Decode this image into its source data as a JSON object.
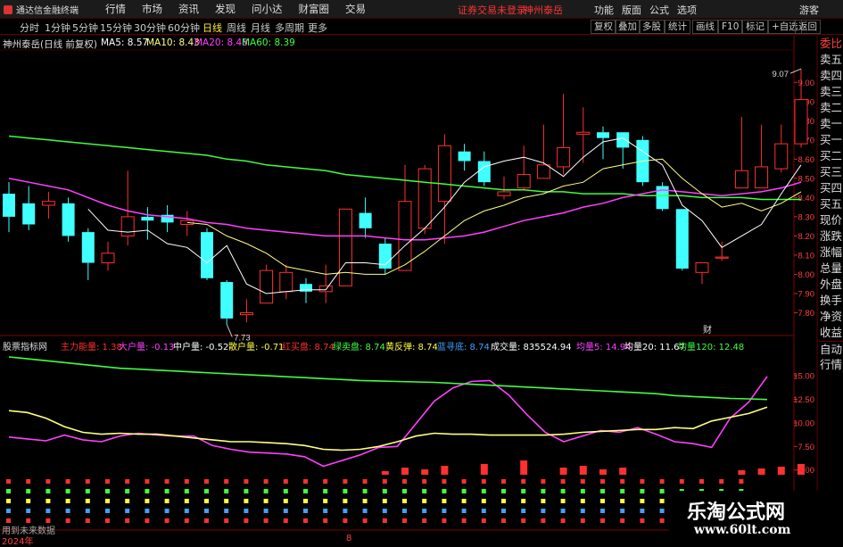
{
  "menubar": {
    "app": "通达信金融终端",
    "items": [
      "行情",
      "市场",
      "资讯",
      "发现",
      "问小达",
      "财富圈",
      "交易"
    ],
    "login": "证券交易未登录",
    "stock": "神州泰岳",
    "right": [
      "功能",
      "版面",
      "公式",
      "选项"
    ],
    "guest": "游客"
  },
  "tabs": {
    "items": [
      "分时",
      "1分钟",
      "5分钟",
      "15分钟",
      "30分钟",
      "60分钟",
      "日线",
      "周线",
      "月线",
      "多周期",
      "更多"
    ],
    "active": "日线",
    "right": [
      "复权",
      "叠加",
      "多股",
      "统计",
      "画线",
      "F10",
      "标记",
      "+自选",
      "返回"
    ]
  },
  "info": {
    "title": "神州泰岳(日线 前复权)",
    "ma5": "MA5: 8.57",
    "ma10": "MA10: 8.43",
    "ma20": "MA20: 8.48",
    "ma60": "MA60: 8.39"
  },
  "indicator": {
    "name": "股票指标网",
    "items": [
      {
        "t": "主力能量: 1.38",
        "c": "#ff3030"
      },
      {
        "t": "大户量: -0.13",
        "c": "#ff40ff"
      },
      {
        "t": "中户量: -0.52",
        "c": "#ffffff"
      },
      {
        "t": "散户量: -0.71",
        "c": "#ffff40"
      },
      {
        "t": "红买盘: 8.74",
        "c": "#ff3030"
      },
      {
        "t": "绿卖盘: 8.74",
        "c": "#40ff40"
      },
      {
        "t": "黄反弹: 8.74",
        "c": "#ffff40"
      },
      {
        "t": "蓝寻底: 8.74",
        "c": "#40a0ff"
      },
      {
        "t": "成交量: 835524.94",
        "c": "#ffffff"
      },
      {
        "t": "均量5: 14.94",
        "c": "#ff40ff"
      },
      {
        "t": "均量20: 11.67",
        "c": "#ffffff"
      },
      {
        "t": "均量120: 12.48",
        "c": "#40ff40"
      }
    ]
  },
  "sidebar": {
    "items": [
      "委比",
      "卖五",
      "卖四",
      "卖三",
      "卖二",
      "卖一",
      "买一",
      "买二",
      "买三",
      "买四",
      "买五",
      "现价",
      "涨跌",
      "涨幅",
      "总量",
      "外盘",
      "换手",
      "净资",
      "收益"
    ],
    "bottom": [
      "自动",
      "行情"
    ]
  },
  "labels": {
    "high": "9.07",
    "low": "7.73",
    "cai": "财",
    "nofuture": "用到未来数据",
    "year": "2024年",
    "month": "8"
  },
  "watermark": {
    "line1": "乐淘公式网",
    "line2": "www.60lt.com"
  },
  "colors": {
    "up": "#ff3030",
    "down": "#40ffff",
    "ma5": "#ffffff",
    "ma10": "#ffff80",
    "ma20": "#ff40ff",
    "ma60": "#40ff40"
  },
  "chart_data": [
    {
      "type": "candlestick",
      "ylim": [
        7.7,
        9.15
      ],
      "yticks": [
        7.8,
        7.9,
        8.0,
        8.1,
        8.2,
        8.3,
        8.4,
        8.5,
        8.6,
        8.7,
        8.8,
        8.9,
        9.0
      ],
      "candles": [
        [
          8.42,
          8.3,
          8.48,
          8.22
        ],
        [
          8.37,
          8.26,
          8.46,
          8.23
        ],
        [
          8.36,
          8.38,
          8.43,
          8.29
        ],
        [
          8.37,
          8.2,
          8.4,
          8.17
        ],
        [
          8.22,
          8.06,
          8.24,
          7.97
        ],
        [
          8.06,
          8.11,
          8.17,
          8.02
        ],
        [
          8.2,
          8.3,
          8.54,
          8.15
        ],
        [
          8.3,
          8.28,
          8.35,
          8.18
        ],
        [
          8.31,
          8.27,
          8.36,
          8.22
        ],
        [
          8.26,
          8.28,
          8.33,
          8.2
        ],
        [
          8.22,
          7.98,
          8.24,
          7.97
        ],
        [
          7.96,
          7.77,
          7.97,
          7.74
        ],
        [
          7.79,
          7.8,
          7.87,
          7.75
        ],
        [
          7.85,
          8.02,
          8.05,
          7.85
        ],
        [
          7.91,
          8.01,
          8.05,
          7.87
        ],
        [
          7.95,
          7.91,
          7.98,
          7.85
        ],
        [
          7.91,
          7.94,
          8.05,
          7.85
        ],
        [
          7.94,
          8.34,
          8.34,
          7.94
        ],
        [
          8.32,
          8.24,
          8.4,
          8.19
        ],
        [
          8.16,
          8.03,
          8.19,
          8.0
        ],
        [
          8.02,
          8.38,
          8.57,
          8.02
        ],
        [
          8.24,
          8.55,
          8.57,
          8.21
        ],
        [
          8.38,
          8.67,
          8.73,
          8.16
        ],
        [
          8.64,
          8.59,
          8.68,
          8.54
        ],
        [
          8.59,
          8.48,
          8.64,
          8.46
        ],
        [
          8.41,
          8.43,
          8.51,
          8.39
        ],
        [
          8.45,
          8.52,
          8.67,
          8.44
        ],
        [
          8.5,
          8.57,
          8.78,
          8.51
        ],
        [
          8.56,
          8.66,
          8.94,
          8.52
        ],
        [
          8.73,
          8.74,
          8.87,
          8.58
        ],
        [
          8.74,
          8.71,
          8.77,
          8.6
        ],
        [
          8.74,
          8.66,
          8.7,
          8.55
        ],
        [
          8.7,
          8.48,
          8.72,
          8.46
        ],
        [
          8.46,
          8.34,
          8.48,
          8.33
        ],
        [
          8.34,
          8.03,
          8.34,
          8.02
        ],
        [
          8.01,
          8.06,
          8.06,
          7.95
        ],
        [
          8.09,
          8.09,
          8.17,
          8.07
        ],
        [
          8.45,
          8.54,
          8.82,
          8.45
        ],
        [
          8.45,
          8.56,
          8.78,
          8.46
        ],
        [
          8.55,
          8.68,
          8.78,
          8.53
        ],
        [
          8.68,
          8.91,
          9.07,
          8.66
        ]
      ],
      "ma": {
        "ma5": [
          null,
          null,
          null,
          null,
          8.34,
          8.23,
          8.22,
          8.23,
          8.16,
          8.14,
          8.06,
          8.15,
          7.95,
          7.9,
          7.91,
          7.92,
          7.92,
          8.06,
          8.06,
          8.05,
          8.15,
          8.24,
          8.35,
          8.48,
          8.56,
          8.59,
          8.61,
          8.58,
          8.51,
          8.61,
          8.69,
          8.71,
          8.64,
          8.57,
          8.36,
          8.28,
          8.14,
          8.2,
          8.26,
          8.42,
          8.57
        ],
        "ma10": [
          null,
          null,
          null,
          null,
          null,
          null,
          null,
          null,
          null,
          8.27,
          8.26,
          8.2,
          8.16,
          8.11,
          8.04,
          8.02,
          8.0,
          8.01,
          8.0,
          8.0,
          8.05,
          8.12,
          8.2,
          8.28,
          8.33,
          8.36,
          8.4,
          8.42,
          8.46,
          8.48,
          8.55,
          8.57,
          8.59,
          8.6,
          8.5,
          8.42,
          8.35,
          8.37,
          8.33,
          8.37,
          8.43
        ],
        "ma20": [
          8.5,
          8.48,
          8.46,
          8.44,
          8.4,
          8.36,
          8.33,
          8.31,
          8.3,
          8.29,
          8.27,
          8.26,
          8.24,
          8.23,
          8.22,
          8.21,
          8.2,
          8.2,
          8.2,
          8.19,
          8.18,
          8.18,
          8.19,
          8.2,
          8.22,
          8.25,
          8.28,
          8.3,
          8.32,
          8.35,
          8.37,
          8.4,
          8.42,
          8.44,
          8.43,
          8.42,
          8.41,
          8.42,
          8.43,
          8.45,
          8.48
        ],
        "ma60": [
          8.72,
          8.71,
          8.7,
          8.69,
          8.68,
          8.67,
          8.66,
          8.65,
          8.64,
          8.63,
          8.62,
          8.6,
          8.59,
          8.57,
          8.56,
          8.55,
          8.54,
          8.52,
          8.51,
          8.5,
          8.49,
          8.48,
          8.47,
          8.46,
          8.45,
          8.44,
          8.44,
          8.43,
          8.43,
          8.42,
          8.42,
          8.42,
          8.41,
          8.41,
          8.41,
          8.4,
          8.4,
          8.4,
          8.39,
          8.39,
          8.39
        ]
      }
    },
    {
      "type": "line",
      "ylim": [
        4.5,
        17.0
      ],
      "yticks": [
        5.0,
        7.5,
        10.0,
        12.5,
        15.0
      ],
      "series": [
        {
          "name": "均量5",
          "color": "#ff40ff",
          "values": [
            8.5,
            8.3,
            8.1,
            8.7,
            8.2,
            8.0,
            8.6,
            8.9,
            8.7,
            8.6,
            8.6,
            7.6,
            7.2,
            6.9,
            6.8,
            6.7,
            6.4,
            5.4,
            6.0,
            6.6,
            7.4,
            7.5,
            9.9,
            12.3,
            13.7,
            14.4,
            14.5,
            13.0,
            10.9,
            9.0,
            8.0,
            8.6,
            9.2,
            9.0,
            9.5,
            8.8,
            8.0,
            7.8,
            7.4,
            10.5,
            12.2,
            14.94
          ]
        },
        {
          "name": "均量20",
          "color": "#ffff80",
          "values": [
            11.3,
            11.1,
            10.5,
            9.6,
            9.0,
            8.8,
            8.9,
            8.8,
            8.8,
            8.6,
            8.4,
            8.2,
            8.0,
            8.0,
            7.9,
            7.8,
            7.6,
            7.2,
            7.1,
            7.2,
            7.5,
            8.0,
            8.6,
            8.9,
            8.8,
            8.8,
            8.7,
            8.7,
            8.7,
            8.7,
            8.8,
            9.0,
            9.1,
            9.2,
            9.3,
            9.3,
            9.5,
            9.4,
            10.2,
            10.6,
            11.0,
            11.67
          ]
        },
        {
          "name": "均量120",
          "color": "#40ff40",
          "values": [
            17.0,
            16.8,
            16.6,
            16.4,
            16.2,
            16.0,
            15.8,
            15.7,
            15.6,
            15.5,
            15.4,
            15.3,
            15.2,
            15.1,
            15.0,
            14.9,
            14.8,
            14.7,
            14.6,
            14.5,
            14.45,
            14.4,
            14.35,
            14.3,
            14.2,
            14.1,
            14.0,
            13.9,
            13.8,
            13.7,
            13.6,
            13.5,
            13.4,
            13.3,
            13.2,
            13.1,
            12.9,
            12.8,
            12.7,
            12.6,
            12.55,
            12.48
          ]
        }
      ]
    }
  ]
}
